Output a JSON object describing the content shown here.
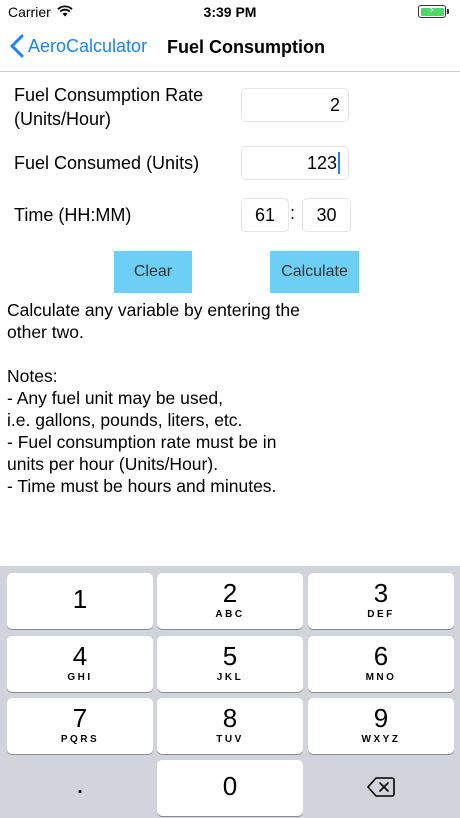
{
  "status_bar": {
    "carrier": "Carrier",
    "time": "3:39 PM",
    "battery_symbol": "⚡"
  },
  "nav": {
    "back_label": "AeroCalculator",
    "title": "Fuel Consumption"
  },
  "form": {
    "rate_label_line1": "Fuel Consumption Rate",
    "rate_label_line2": "(Units/Hour)",
    "rate_value": "2",
    "consumed_label": "Fuel Consumed (Units)",
    "consumed_value": "123",
    "time_label": "Time (HH:MM)",
    "hours_value": "61",
    "time_separator": ":",
    "minutes_value": "30"
  },
  "buttons": {
    "clear_label": "Clear",
    "calculate_label": "Calculate"
  },
  "help_text": "Calculate any variable by entering the\nother two.\n\nNotes:\n - Any fuel unit may be used,\n   i.e. gallons, pounds, liters, etc.\n - Fuel consumption rate must be in\n   units per hour (Units/Hour).\n - Time must be hours and minutes.",
  "keyboard": {
    "keys": [
      {
        "digit": "1",
        "letters": ""
      },
      {
        "digit": "2",
        "letters": "ABC"
      },
      {
        "digit": "3",
        "letters": "DEF"
      },
      {
        "digit": "4",
        "letters": "GHI"
      },
      {
        "digit": "5",
        "letters": "JKL"
      },
      {
        "digit": "6",
        "letters": "MNO"
      },
      {
        "digit": "7",
        "letters": "PQRS"
      },
      {
        "digit": "8",
        "letters": "TUV"
      },
      {
        "digit": "9",
        "letters": "WXYZ"
      }
    ],
    "decimal": ".",
    "zero": "0"
  },
  "colors": {
    "accent": "#1a82fb",
    "button": "#6ecff6",
    "keyboard_bg": "#d1d4da"
  }
}
